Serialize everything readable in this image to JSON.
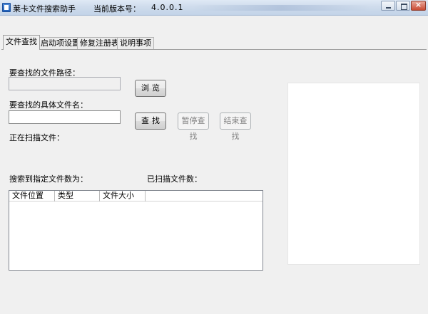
{
  "window": {
    "title": "莱卡文件搜索助手",
    "version_label": "当前版本号：",
    "version_value": "4.0.0.1",
    "controls": {
      "close_glyph": "×"
    }
  },
  "tabs": [
    {
      "label": "文件查找",
      "active": true
    },
    {
      "label": "启动项设置",
      "active": false
    },
    {
      "label": "修复注册表",
      "active": false
    },
    {
      "label": "说明事项",
      "active": false
    }
  ],
  "search": {
    "path_label": "要查找的文件路径：",
    "path_value": "",
    "browse_label": "浏览",
    "filename_label": "要查找的具体文件名：",
    "filename_value": "",
    "find_label": "查找",
    "pause_label": "暂停查找",
    "stop_label": "结束查找",
    "scanning_label": "正在扫描文件：",
    "found_count_label": "搜索到指定文件数为：",
    "scanned_count_label": "已扫描文件数："
  },
  "results": {
    "columns": [
      "文件位置",
      "类型",
      "文件大小"
    ],
    "rows": []
  }
}
